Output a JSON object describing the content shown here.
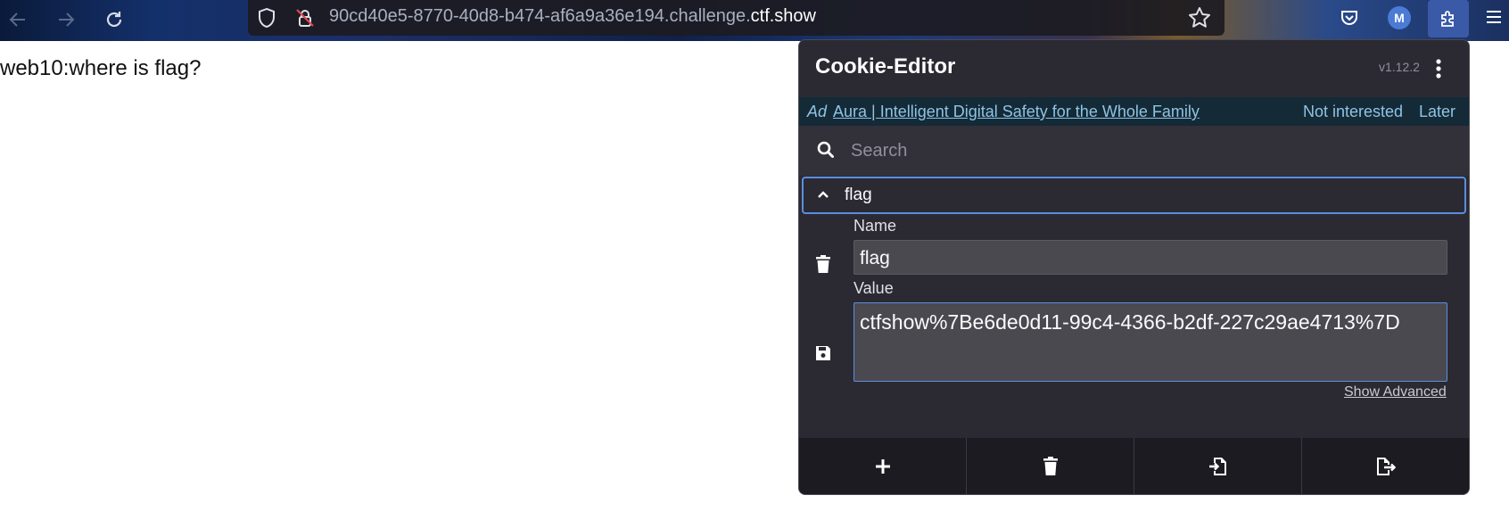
{
  "browser": {
    "url_prefix": "90cd40e5-8770-40d8-b474-af6a9a36e194.challenge.",
    "url_domain": "ctf.show",
    "profile_initial": "M"
  },
  "page": {
    "text": "web10:where is flag?"
  },
  "extension": {
    "title": "Cookie-Editor",
    "version": "v1.12.2",
    "ad": {
      "label": "Ad",
      "link_text": "Aura | Intelligent Digital Safety for the Whole Family",
      "not_interested": "Not interested",
      "later": "Later"
    },
    "search": {
      "placeholder": "Search",
      "value": ""
    },
    "cookie": {
      "header_name": "flag",
      "name_label": "Name",
      "name_value": "flag",
      "value_label": "Value",
      "value": "ctfshow%7Be6de0d11-99c4-4366-b2df-227c29ae4713%7D",
      "show_advanced": "Show Advanced"
    }
  },
  "colors": {
    "panel_bg": "#2b2a33",
    "accent": "#5b8de0",
    "ad_link": "#8fc3e4",
    "footer_bg": "#1c1b22"
  }
}
